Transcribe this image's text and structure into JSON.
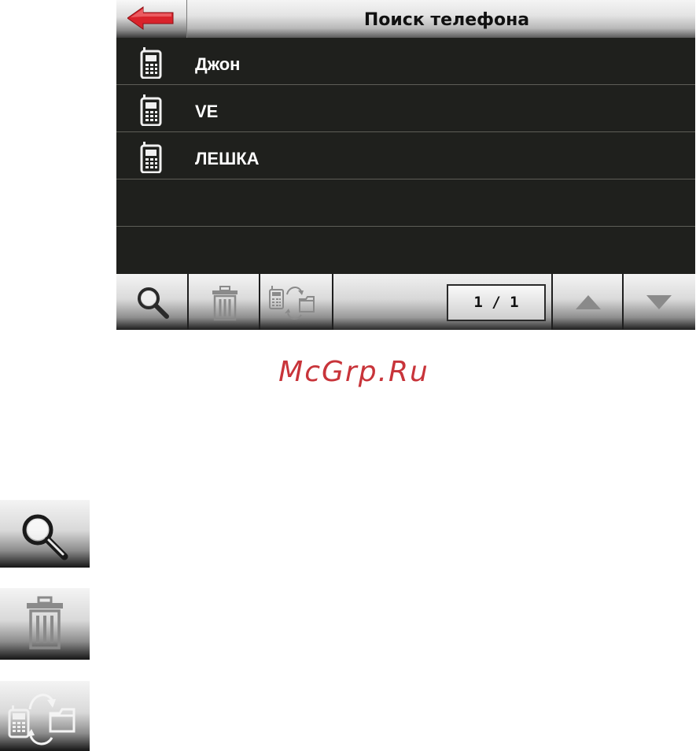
{
  "header": {
    "title": "Поиск телефона",
    "back_icon": "red-arrow-left-icon"
  },
  "phones": [
    {
      "name": "Джон",
      "icon": "mobile-phone-icon"
    },
    {
      "name": "VE",
      "icon": "mobile-phone-icon"
    },
    {
      "name": "ЛЕШКА",
      "icon": "mobile-phone-icon"
    },
    {
      "name": "",
      "icon": ""
    },
    {
      "name": "",
      "icon": ""
    }
  ],
  "toolbar": {
    "search_icon": "magnifier-icon",
    "delete_icon": "trash-can-icon",
    "transfer_icon": "phone-sync-folder-icon",
    "page_indicator": "1 / 1",
    "up_icon": "triangle-up-icon",
    "down_icon": "triangle-down-icon"
  },
  "watermark": "McGrp.Ru",
  "legend": [
    {
      "icon": "magnifier-icon"
    },
    {
      "icon": "trash-can-icon"
    },
    {
      "icon": "phone-sync-folder-icon"
    }
  ],
  "colors": {
    "accent_red": "#d9232b",
    "list_background": "#1f201d",
    "watermark": "#c8343a"
  }
}
